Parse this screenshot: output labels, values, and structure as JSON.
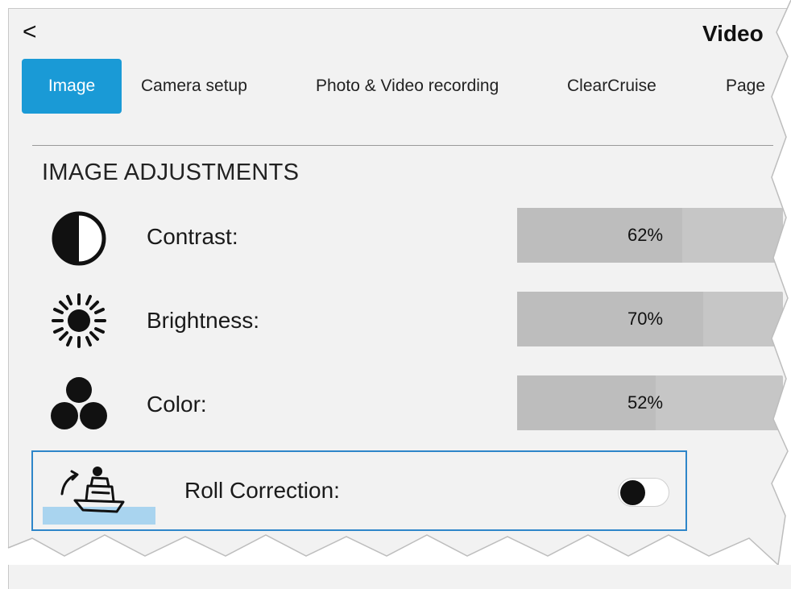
{
  "header": {
    "back_icon": "chevron-left-icon",
    "back_glyph": "<",
    "title": "Video"
  },
  "tabs": [
    {
      "label": "Image",
      "active": true
    },
    {
      "label": "Camera setup",
      "active": false
    },
    {
      "label": "Photo & Video recording",
      "active": false
    },
    {
      "label": "ClearCruise",
      "active": false
    },
    {
      "label": "Page",
      "active": false
    }
  ],
  "section": {
    "title": "IMAGE ADJUSTMENTS"
  },
  "adjustments": {
    "contrast": {
      "label": "Contrast:",
      "value_text": "62%",
      "level": 0.62,
      "icon": "contrast-icon"
    },
    "brightness": {
      "label": "Brightness:",
      "value_text": "70%",
      "level": 0.7,
      "icon": "brightness-icon"
    },
    "color": {
      "label": "Color:",
      "value_text": "52%",
      "level": 0.52,
      "icon": "color-icon"
    }
  },
  "roll_correction": {
    "label": "Roll Correction:",
    "enabled": false,
    "icon": "boat-roll-icon"
  },
  "colors": {
    "accent": "#1a9ad6",
    "focus_border": "#2e86c9",
    "slider_bg": "#c6c6c6",
    "panel_bg": "#f2f2f2"
  }
}
